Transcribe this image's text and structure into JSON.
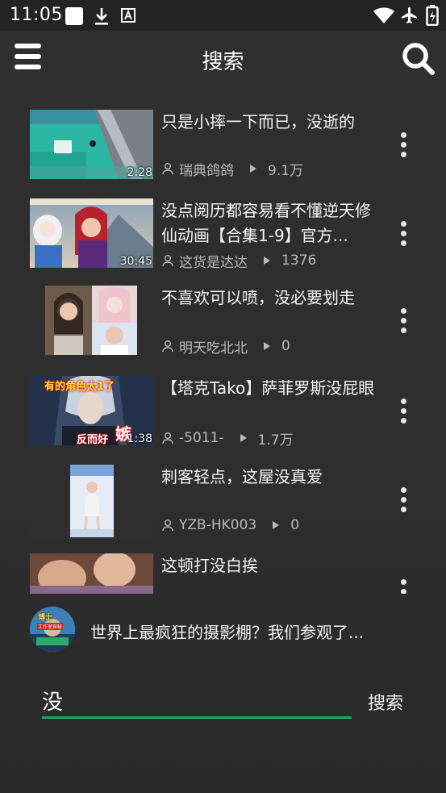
{
  "status_bar": {
    "time": "11:05",
    "left_icons": [
      "notification-square-icon",
      "download-icon",
      "font-icon"
    ],
    "right_icons": [
      "wifi-icon",
      "airplane-mode-icon",
      "battery-charging-icon"
    ]
  },
  "app_bar": {
    "title": "搜索",
    "left_icon": "hamburger-menu-icon",
    "right_icon": "search-icon"
  },
  "results": [
    {
      "title": "只是小摔一下而已，没逝的",
      "duration": "2:28",
      "author": "瑞典鸽鸽",
      "views": "9.1万"
    },
    {
      "title": "没点阅历都容易看不懂逆天修仙动画【合集1-9】官方...",
      "duration": "30:45",
      "author": "这货是达达",
      "views": "1376"
    },
    {
      "title": "不喜欢可以喷，没必要划走",
      "duration": "",
      "author": "明天吃北北",
      "views": "0"
    },
    {
      "title": "【塔克Tako】萨菲罗斯没屁眼",
      "duration": "1:38",
      "author": "-5011-",
      "views": "1.7万",
      "thumb_text": [
        "有的角色太1了",
        "反而好",
        "嫉"
      ]
    },
    {
      "title": "刺客轻点，这屋没真爱",
      "duration": "",
      "author": "YZB-HK003",
      "views": "0"
    },
    {
      "title": "这顿打没白挨",
      "duration": "",
      "author": "",
      "views": ""
    }
  ],
  "suggestion": {
    "text": "世界上最疯狂的摄影棚？我们参观了...",
    "avatar_text": [
      "博士",
      "工作室探秘"
    ]
  },
  "search_box": {
    "value": "没",
    "submit_label": "搜索"
  },
  "colors": {
    "accent": "#1fa463",
    "background": "#2e2e2e",
    "status_bar": "#232323",
    "meta_text": "#b9b9b9"
  }
}
